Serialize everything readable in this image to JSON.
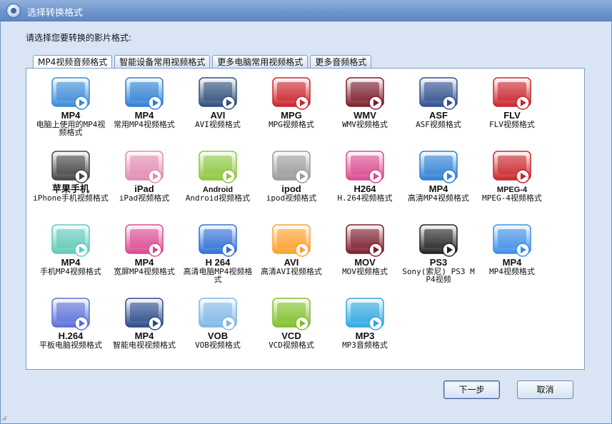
{
  "window": {
    "title": "选择转换格式"
  },
  "prompt": "请选择您要转换的影片格式:",
  "tabs": [
    {
      "label": "MP4视频音频格式",
      "active": true
    },
    {
      "label": "智能设备常用视频格式",
      "active": false
    },
    {
      "label": "更多电脑常用视频格式",
      "active": false
    },
    {
      "label": "更多音频格式",
      "active": false
    }
  ],
  "formats": [
    {
      "label": "电脑上使用的MP4视频格式",
      "badge": "MP4",
      "icon": "computer-icon",
      "color": "#3a8ad6"
    },
    {
      "label": "常用MP4视频格式",
      "badge": "MP4",
      "icon": "tablet-play-icon",
      "color": "#2e7fd4"
    },
    {
      "label": "AVI视频格式",
      "badge": "AVI",
      "icon": "realplayer-icon",
      "color": "#2d4e7a"
    },
    {
      "label": "MPG视频格式",
      "badge": "MPG",
      "icon": "realplayer-box-icon",
      "color": "#c9252b"
    },
    {
      "label": "WMV视频格式",
      "badge": "WMV",
      "icon": "film-reel-icon",
      "color": "#7a1c2b"
    },
    {
      "label": "ASF视频格式",
      "badge": "ASF",
      "icon": "photo-frame-icon",
      "color": "#2f4f8f"
    },
    {
      "label": "FLV视频格式",
      "badge": "FLV",
      "icon": "flash-icon",
      "color": "#c9252b"
    },
    {
      "label": "iPhone手机视频格式",
      "badge": "苹果手机",
      "icon": "iphone-icon",
      "color": "#444444"
    },
    {
      "label": "iPad视频格式",
      "badge": "iPad",
      "icon": "ipad-icon",
      "color": "#e18ab0"
    },
    {
      "label": "Android视频格式",
      "badge": "Android",
      "icon": "android-icon",
      "color": "#8dc63f"
    },
    {
      "label": "ipod视频格式",
      "badge": "ipod",
      "icon": "ipod-icon",
      "color": "#9a9a9a"
    },
    {
      "label": "H.264视频格式",
      "badge": "H264",
      "icon": "folder-icon",
      "color": "#d9488f"
    },
    {
      "label": "高清MP4视频格式",
      "badge": "MP4",
      "icon": "cubes-icon",
      "color": "#2f7fd6"
    },
    {
      "label": "MPEG-4视频格式",
      "badge": "MPEG-4",
      "icon": "film-disc-icon",
      "color": "#c9252b"
    },
    {
      "label": "手机MP4视频格式",
      "badge": "MP4",
      "icon": "phone-color-icon",
      "color": "#5fc9b8"
    },
    {
      "label": "宽屏MP4视频格式",
      "badge": "MP4",
      "icon": "disc-pink-icon",
      "color": "#d9488f"
    },
    {
      "label": "高清电脑MP4视频格式",
      "badge": "H 264",
      "icon": "monitor-gear-icon",
      "color": "#2f6fd6"
    },
    {
      "label": "高清AVI视频格式",
      "badge": "AVI",
      "icon": "photos-icon",
      "color": "#ff9f2a"
    },
    {
      "label": "MOV视频格式",
      "badge": "MOV",
      "icon": "movie-icon",
      "color": "#7a1c2b"
    },
    {
      "label": "Sony(索尼) PS3 MP4视频",
      "badge": "PS3",
      "icon": "ps3-icon",
      "color": "#222222"
    },
    {
      "label": "MP4视频格式",
      "badge": "MP4",
      "icon": "box-blue-icon",
      "color": "#3a8ee6"
    },
    {
      "label": "平板电脑视频格式",
      "badge": "H.264",
      "icon": "tablet-icon",
      "color": "#5a6fd6"
    },
    {
      "label": "智能电视视频格式",
      "badge": "MP4",
      "icon": "tv-icon",
      "color": "#2b4a8a"
    },
    {
      "label": "VOB视频格式",
      "badge": "VOB",
      "icon": "drive-icon",
      "color": "#7fb6e6"
    },
    {
      "label": "VCD视频格式",
      "badge": "VCD",
      "icon": "dvd-disc-icon",
      "color": "#7fbf2a"
    },
    {
      "label": "MP3音频格式",
      "badge": "MP3",
      "icon": "play-circle-icon",
      "color": "#2fa8e0"
    }
  ],
  "buttons": {
    "next": "下一步",
    "cancel": "取消"
  }
}
